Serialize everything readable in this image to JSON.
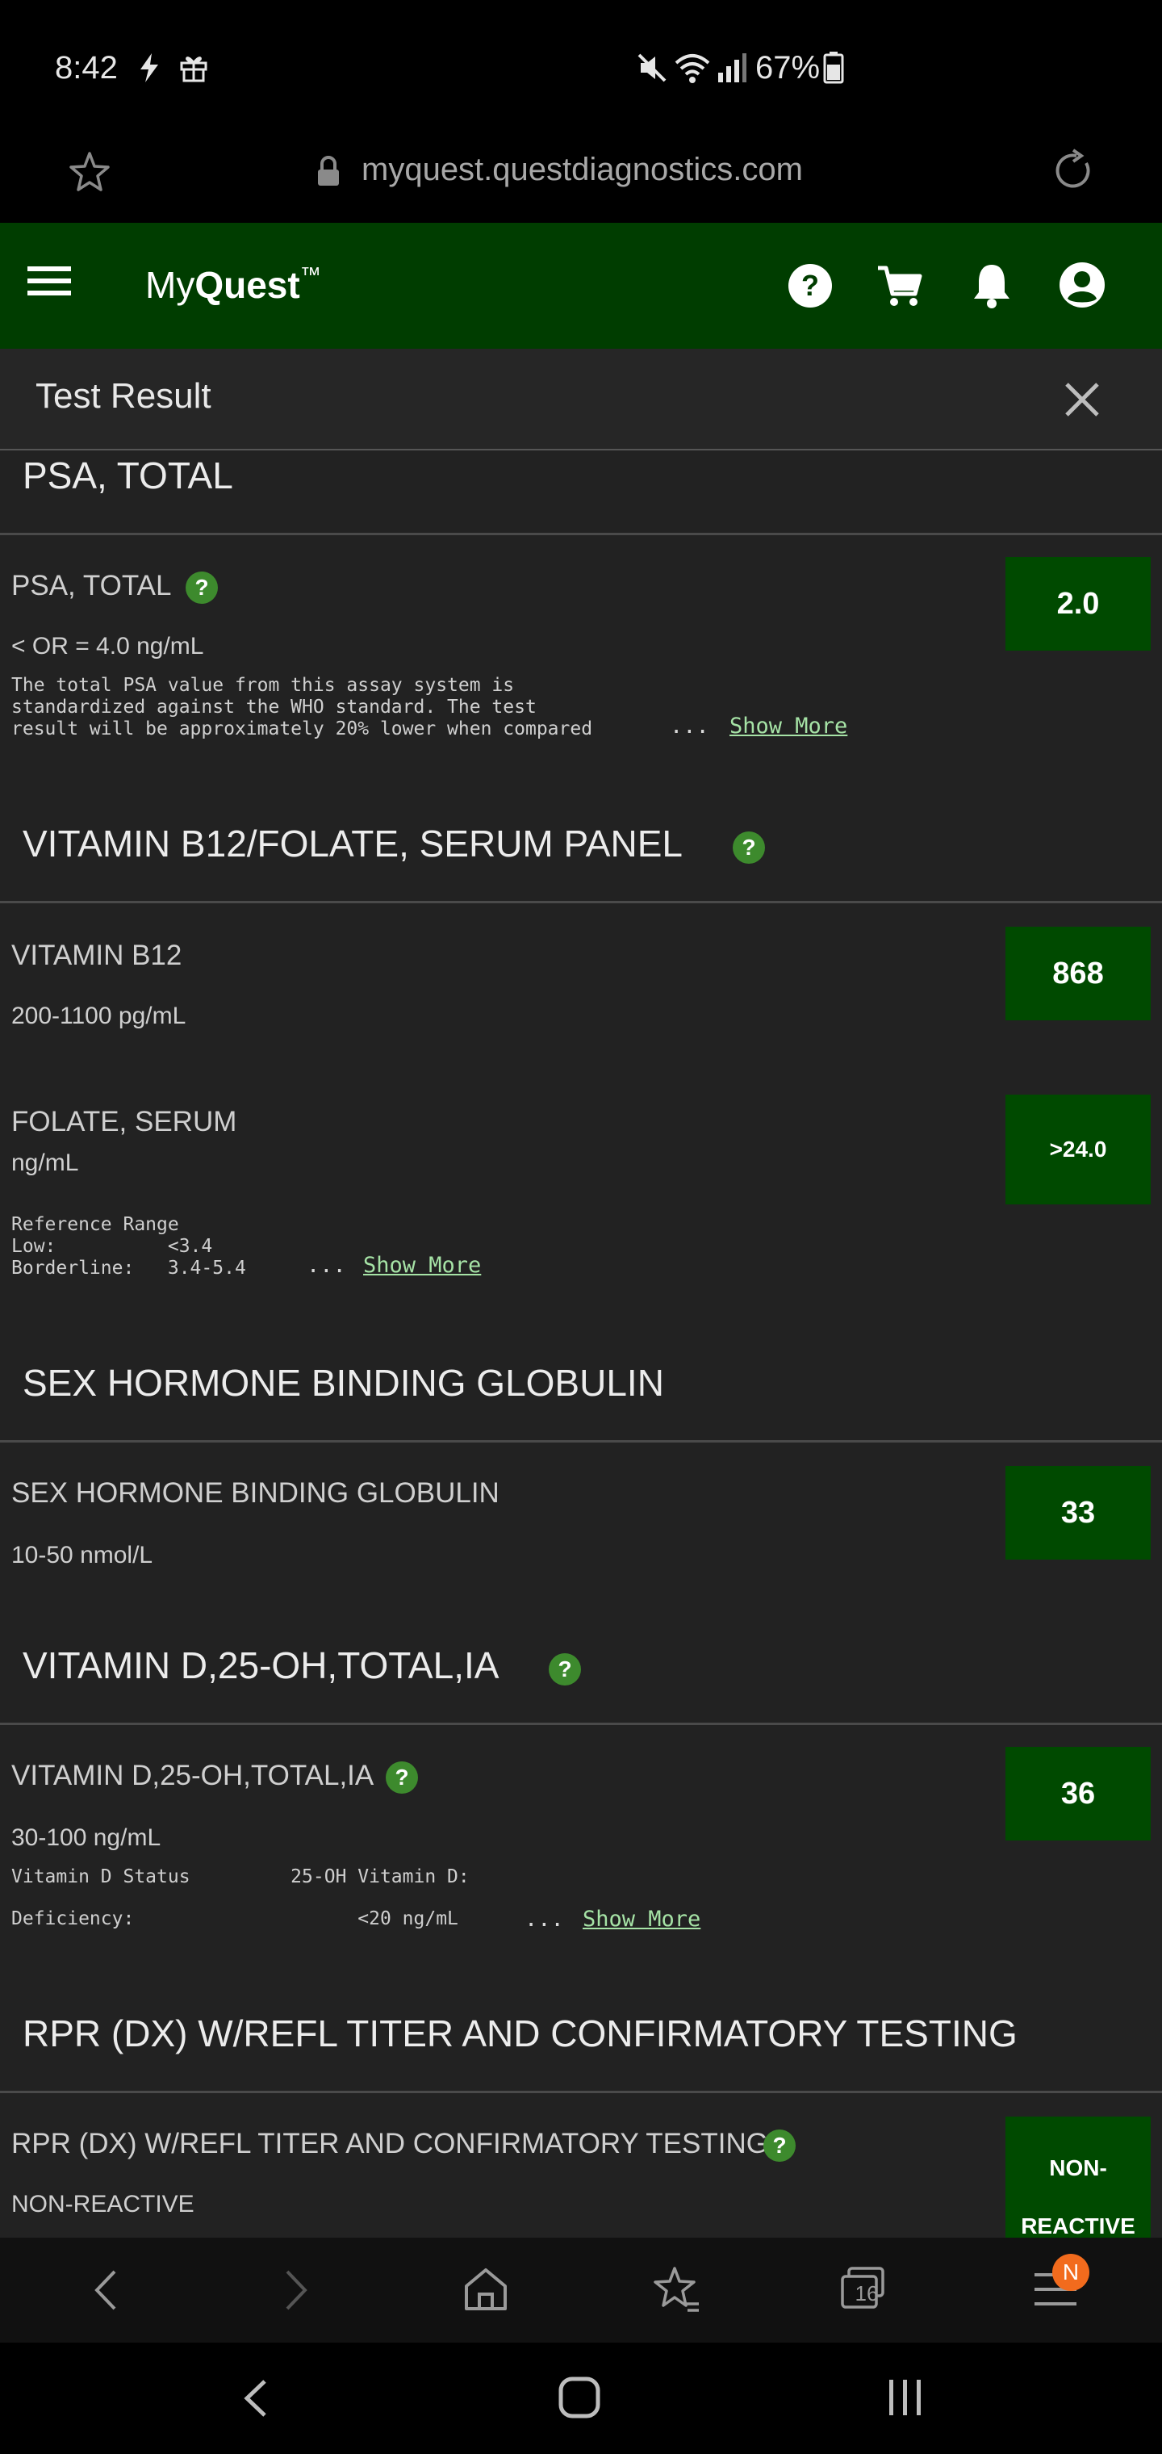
{
  "status_bar": {
    "time": "8:42",
    "battery": "67%"
  },
  "browser": {
    "url": "myquest.questdiagnostics.com"
  },
  "app": {
    "logo_my": "My",
    "logo_quest": "Quest",
    "logo_tm": "™"
  },
  "subheader": {
    "title": "Test Result"
  },
  "sections": {
    "psa": {
      "title": "PSA, TOTAL",
      "test_name": "PSA, TOTAL",
      "range": "< OR = 4.0  ng/mL",
      "value": "2.0",
      "note": "The total PSA value from this assay system is\nstandardized against the WHO standard. The test\nresult will be approximately 20% lower when compared",
      "ellipsis": "...",
      "show_more": "Show More"
    },
    "b12": {
      "title": "VITAMIN B12/FOLATE, SERUM PANEL",
      "test1_name": "VITAMIN B12",
      "test1_range": "200-1100  pg/mL",
      "test1_value": "868",
      "test2_name": "FOLATE, SERUM",
      "test2_unit": "ng/mL",
      "test2_value": ">24.0",
      "test2_note": "Reference Range\nLow:          <3.4\nBorderline:   3.4-5.4",
      "ellipsis": "...",
      "show_more": "Show More"
    },
    "shbg": {
      "title": "SEX HORMONE BINDING GLOBULIN",
      "test_name": "SEX HORMONE BINDING GLOBULIN",
      "range": "10-50  nmol/L",
      "value": "33"
    },
    "vitd": {
      "title": "VITAMIN D,25-OH,TOTAL,IA",
      "test_name": "VITAMIN D,25-OH,TOTAL,IA",
      "range": "30-100  ng/mL",
      "value": "36",
      "note_line1": "Vitamin D Status         25-OH Vitamin D:",
      "note_line2": "Deficiency:                    <20 ng/mL",
      "ellipsis": "...",
      "show_more": "Show More"
    },
    "rpr": {
      "title": "RPR (DX) W/REFL TITER AND CONFIRMATORY TESTING",
      "test_name": "RPR (DX) W/REFL TITER AND CONFIRMATORY TESTING",
      "result_text": "NON-REACTIVE",
      "value_line1": "NON-",
      "value_line2": "REACTIVE"
    }
  },
  "help_glyph": "?",
  "browser_nav": {
    "tabs_count": "16",
    "badge": "N"
  },
  "colors": {
    "header_bg": "#003d00",
    "value_bg": "#004a00",
    "link": "#a6e3a6",
    "help": "#3d8a2d",
    "badge": "#f26b1d"
  }
}
